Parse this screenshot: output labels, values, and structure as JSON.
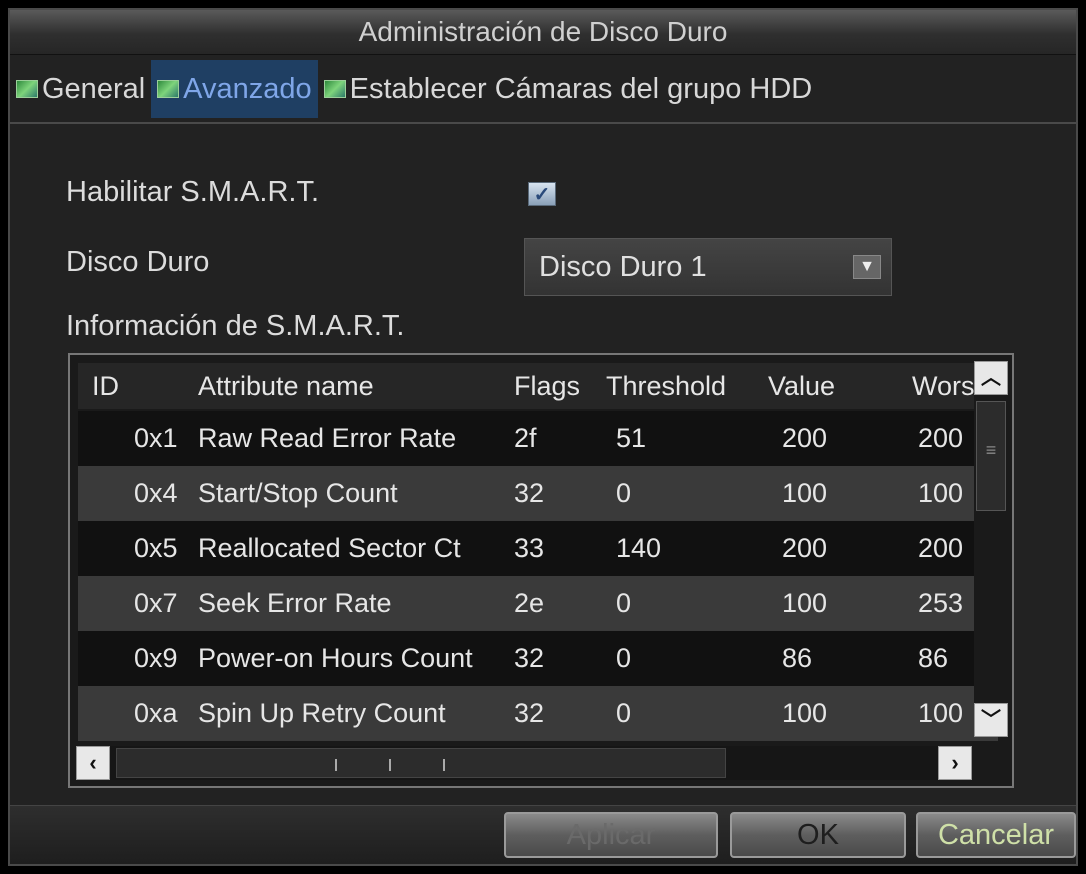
{
  "window": {
    "title": "Administración de Disco Duro"
  },
  "tabs": [
    {
      "label": "General",
      "active": false
    },
    {
      "label": "Avanzado",
      "active": true
    },
    {
      "label": "Establecer Cámaras del grupo HDD",
      "active": false
    }
  ],
  "form": {
    "smart_enable_label": "Habilitar S.M.A.R.T.",
    "smart_enable_checked": true,
    "hdd_label": "Disco Duro",
    "hdd_selected": "Disco Duro 1",
    "smart_info_label": "Información de S.M.A.R.T."
  },
  "table": {
    "columns": [
      "ID",
      "Attribute name",
      "Flags",
      "Threshold",
      "Value",
      "Worst"
    ],
    "rows": [
      [
        "0x1",
        "Raw Read Error Rate",
        "2f",
        "51",
        "200",
        "200"
      ],
      [
        "0x4",
        "Start/Stop Count",
        "32",
        "0",
        "100",
        "100"
      ],
      [
        "0x5",
        "Reallocated Sector Ct",
        "33",
        "140",
        "200",
        "200"
      ],
      [
        "0x7",
        "Seek Error Rate",
        "2e",
        "0",
        "100",
        "253"
      ],
      [
        "0x9",
        "Power-on Hours Count",
        "32",
        "0",
        "86",
        "86"
      ],
      [
        "0xa",
        "Spin Up Retry Count",
        "32",
        "0",
        "100",
        "100"
      ]
    ]
  },
  "buttons": {
    "apply": "Aplicar",
    "ok": "OK",
    "cancel": "Cancelar"
  },
  "colors": {
    "active_tab_bg": "#1f3f63",
    "active_tab_text": "#7fa6e8",
    "window_bg": "#222222"
  },
  "icons": {
    "tab_icon": "image-icon",
    "check": "checkmark-icon",
    "dropdown": "chevron-down-icon"
  }
}
